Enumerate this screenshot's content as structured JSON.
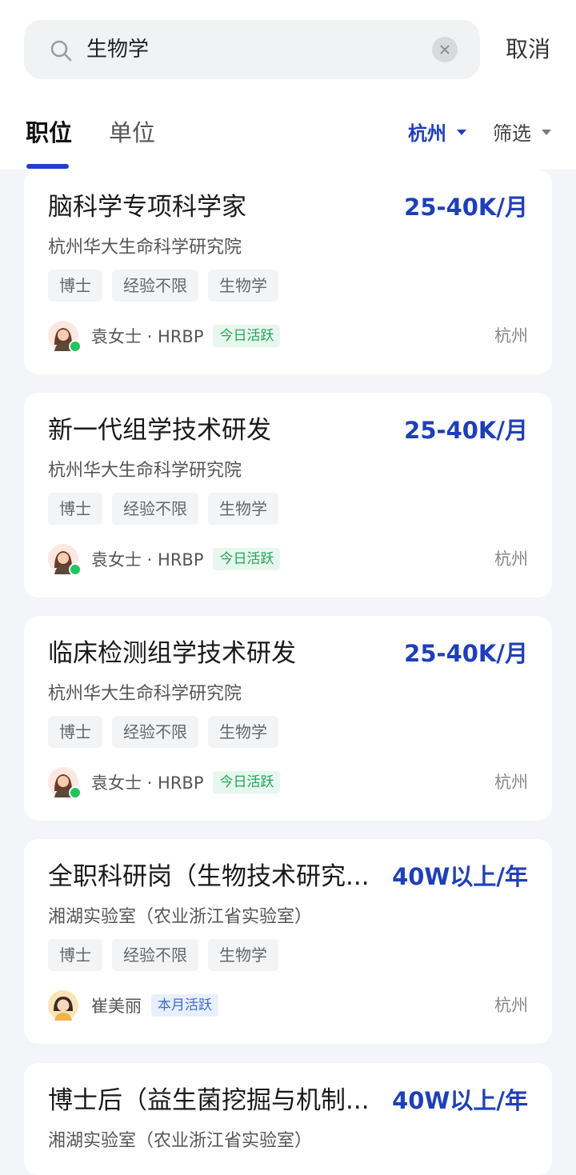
{
  "search": {
    "query": "生物学",
    "cancel_label": "取消"
  },
  "tabs": [
    {
      "label": "职位"
    },
    {
      "label": "单位"
    }
  ],
  "filters": {
    "city": "杭州",
    "filter_label": "筛选"
  },
  "jobs": [
    {
      "title": "脑科学专项科学家",
      "salary": "25-40K/月",
      "company": "杭州华大生命科学研究院",
      "tags": [
        "博士",
        "经验不限",
        "生物学"
      ],
      "recruiter": "袁女士 · HRBP",
      "activity": "今日活跃",
      "location": "杭州"
    },
    {
      "title": "新一代组学技术研发",
      "salary": "25-40K/月",
      "company": "杭州华大生命科学研究院",
      "tags": [
        "博士",
        "经验不限",
        "生物学"
      ],
      "recruiter": "袁女士 · HRBP",
      "activity": "今日活跃",
      "location": "杭州"
    },
    {
      "title": "临床检测组学技术研发",
      "salary": "25-40K/月",
      "company": "杭州华大生命科学研究院",
      "tags": [
        "博士",
        "经验不限",
        "生物学"
      ],
      "recruiter": "袁女士 · HRBP",
      "activity": "今日活跃",
      "location": "杭州"
    },
    {
      "title": "全职科研岗（生物技术研究...",
      "salary": "40W以上/年",
      "company": "湘湖实验室（农业浙江省实验室）",
      "tags": [
        "博士",
        "经验不限",
        "生物学"
      ],
      "recruiter": "崔美丽",
      "activity": "本月活跃",
      "location": "杭州"
    },
    {
      "title": "博士后（益生菌挖掘与机制...",
      "salary": "40W以上/年",
      "company": "湘湖实验室（农业浙江省实验室）"
    }
  ],
  "colors": {
    "accent": "#1f3fb9",
    "active_green": "#22a55b",
    "active_blue": "#3f6ad6"
  }
}
